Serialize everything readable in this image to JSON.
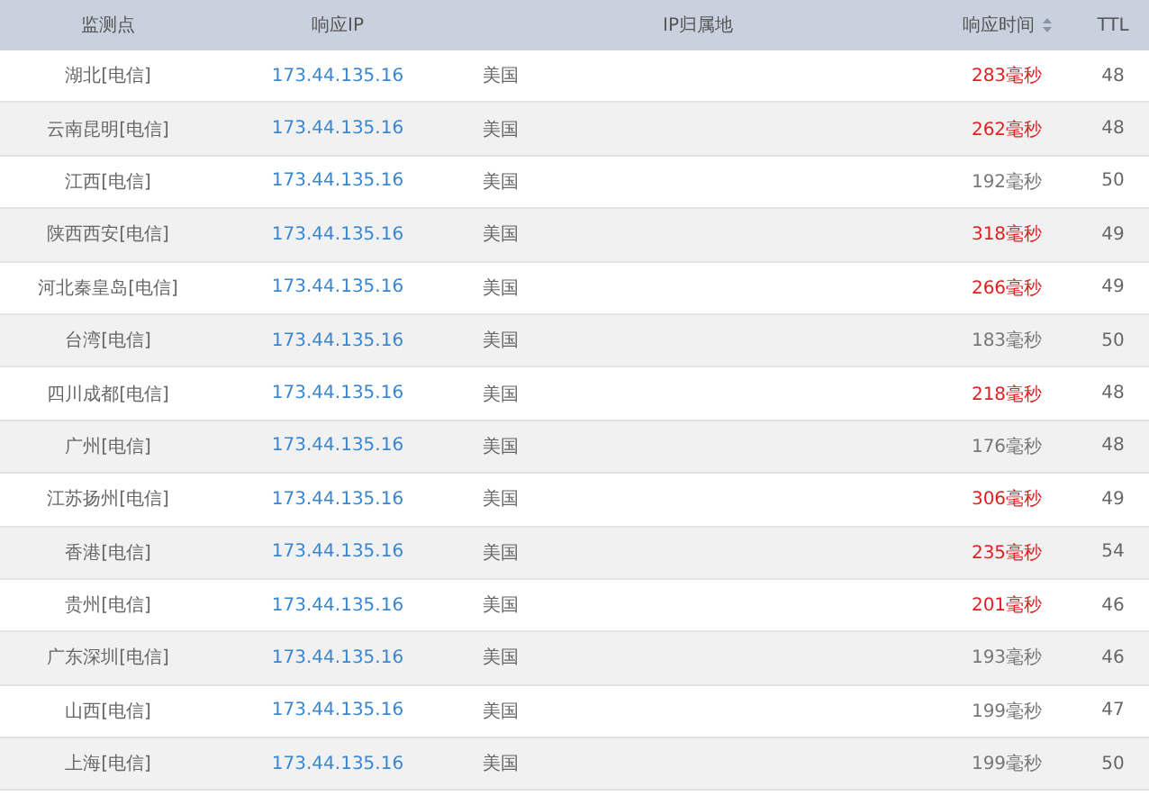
{
  "table": {
    "columns": [
      {
        "label": "监测点",
        "sortable": false
      },
      {
        "label": "响应IP",
        "sortable": false
      },
      {
        "label": "IP归属地",
        "sortable": false
      },
      {
        "label": "响应时间",
        "sortable": true
      },
      {
        "label": "TTL",
        "sortable": false
      }
    ],
    "rows": [
      {
        "node": "湖北[电信]",
        "ip": "173.44.135.16",
        "location": "美国",
        "time": "283毫秒",
        "slow": true,
        "ttl": "48"
      },
      {
        "node": "云南昆明[电信]",
        "ip": "173.44.135.16",
        "location": "美国",
        "time": "262毫秒",
        "slow": true,
        "ttl": "48"
      },
      {
        "node": "江西[电信]",
        "ip": "173.44.135.16",
        "location": "美国",
        "time": "192毫秒",
        "slow": false,
        "ttl": "50"
      },
      {
        "node": "陕西西安[电信]",
        "ip": "173.44.135.16",
        "location": "美国",
        "time": "318毫秒",
        "slow": true,
        "ttl": "49"
      },
      {
        "node": "河北秦皇岛[电信]",
        "ip": "173.44.135.16",
        "location": "美国",
        "time": "266毫秒",
        "slow": true,
        "ttl": "49"
      },
      {
        "node": "台湾[电信]",
        "ip": "173.44.135.16",
        "location": "美国",
        "time": "183毫秒",
        "slow": false,
        "ttl": "50"
      },
      {
        "node": "四川成都[电信]",
        "ip": "173.44.135.16",
        "location": "美国",
        "time": "218毫秒",
        "slow": true,
        "ttl": "48"
      },
      {
        "node": "广州[电信]",
        "ip": "173.44.135.16",
        "location": "美国",
        "time": "176毫秒",
        "slow": false,
        "ttl": "48"
      },
      {
        "node": "江苏扬州[电信]",
        "ip": "173.44.135.16",
        "location": "美国",
        "time": "306毫秒",
        "slow": true,
        "ttl": "49"
      },
      {
        "node": "香港[电信]",
        "ip": "173.44.135.16",
        "location": "美国",
        "time": "235毫秒",
        "slow": true,
        "ttl": "54"
      },
      {
        "node": "贵州[电信]",
        "ip": "173.44.135.16",
        "location": "美国",
        "time": "201毫秒",
        "slow": true,
        "ttl": "46"
      },
      {
        "node": "广东深圳[电信]",
        "ip": "173.44.135.16",
        "location": "美国",
        "time": "193毫秒",
        "slow": false,
        "ttl": "46"
      },
      {
        "node": "山西[电信]",
        "ip": "173.44.135.16",
        "location": "美国",
        "time": "199毫秒",
        "slow": false,
        "ttl": "47"
      },
      {
        "node": "上海[电信]",
        "ip": "173.44.135.16",
        "location": "美国",
        "time": "199毫秒",
        "slow": false,
        "ttl": "50"
      }
    ]
  }
}
